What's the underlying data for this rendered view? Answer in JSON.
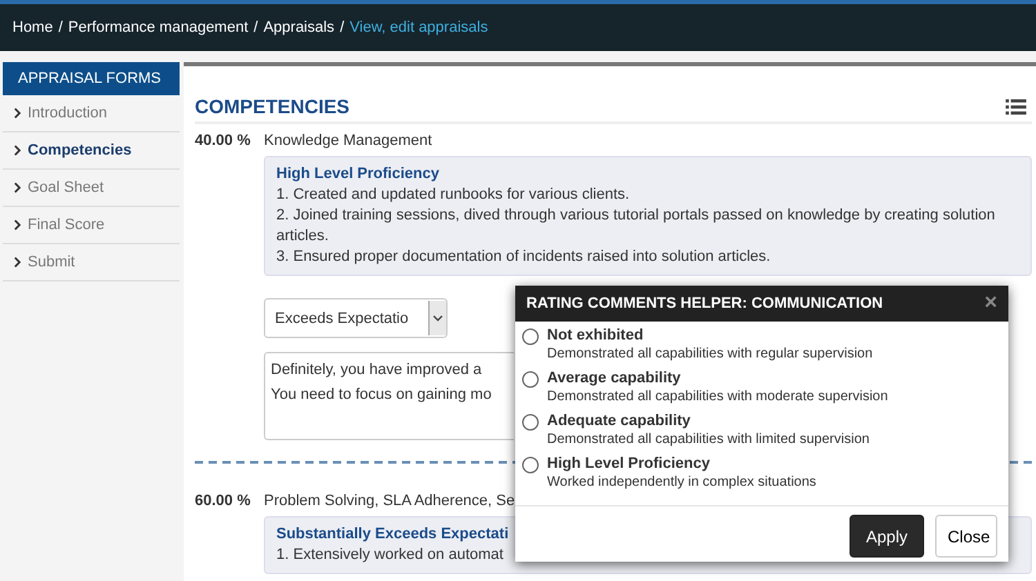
{
  "breadcrumb": [
    {
      "label": "Home",
      "current": false
    },
    {
      "separator": "/",
      "label": "Performance management",
      "current": false
    },
    {
      "separator": "/",
      "label": "Appraisals",
      "current": false
    },
    {
      "separator": "/",
      "label": "View, edit appraisals",
      "current": true
    }
  ],
  "sidebar": {
    "title": "APPRAISAL FORMS",
    "items": [
      {
        "label": "Introduction",
        "selected": false
      },
      {
        "label": "Competencies",
        "selected": true
      },
      {
        "label": "Goal Sheet",
        "selected": false
      },
      {
        "label": "Final Score",
        "selected": false
      },
      {
        "label": "Submit",
        "selected": false
      }
    ]
  },
  "section": {
    "title": "COMPETENCIES"
  },
  "competencies": [
    {
      "weight": "40.00 %",
      "name": "Knowledge Management",
      "box_title": "High Level Proficiency",
      "box_lines": [
        "1. Created and updated runbooks for various clients.",
        "2. Joined training sessions, dived through various tutorial portals passed on knowledge by creating solution articles.",
        "3. Ensured proper documentation of incidents raised into solution articles."
      ],
      "rating": "Exceeds Expectatio",
      "comment_lines": [
        "Definitely, you have improved a",
        "You need to focus on gaining mo"
      ]
    },
    {
      "weight": "60.00 %",
      "name": "Problem Solving, SLA Adherence, Se",
      "box_title": "Substantially Exceeds Expectati",
      "box_lines": [
        "1. Extensively worked on automat"
      ]
    }
  ],
  "dialog": {
    "title": "RATING COMMENTS HELPER: COMMUNICATION",
    "close": "×",
    "options": [
      {
        "label": "Not exhibited",
        "description": "Demonstrated all capabilities with regular supervision",
        "selected": false
      },
      {
        "label": "Average capability",
        "description": "Demonstrated all capabilities with moderate supervision",
        "selected": false
      },
      {
        "label": "Adequate capability",
        "description": "Demonstrated all capabilities with limited supervision",
        "selected": false
      },
      {
        "label": "High Level Proficiency",
        "description": "Worked independently in complex situations",
        "selected": false
      }
    ],
    "buttons": [
      {
        "label": "Apply",
        "kind": "primary"
      },
      {
        "label": "Close",
        "kind": "default"
      }
    ]
  }
}
